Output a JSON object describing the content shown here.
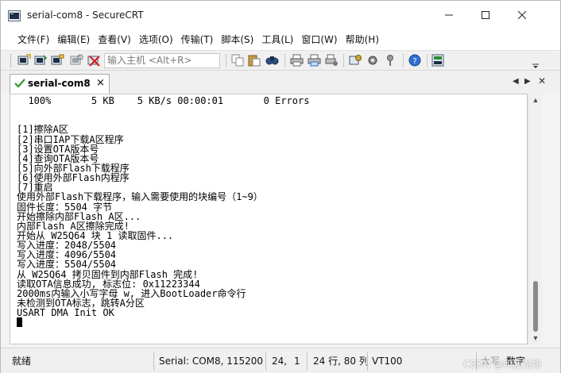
{
  "window": {
    "title": "serial-com8 - SecureCRT"
  },
  "menu": [
    "文件(F)",
    "编辑(E)",
    "查看(V)",
    "选项(O)",
    "传输(T)",
    "脚本(S)",
    "工具(L)",
    "窗口(W)",
    "帮助(H)"
  ],
  "toolbar": {
    "host_placeholder": "输入主机 <Alt+R>"
  },
  "tab": {
    "label": "serial-com8",
    "close": "×"
  },
  "terminal": {
    "lines": [
      "  100%       5 KB    5 KB/s 00:00:01       0 Errors",
      "",
      "",
      "[1]擦除A区",
      "[2]串口IAP下载A区程序",
      "[3]设置OTA版本号",
      "[4]查询OTA版本号",
      "[5]向外部Flash下载程序",
      "[6]使用外部Flash内程序",
      "[7]重启",
      "使用外部Flash下载程序，输入需要使用的块编号（1~9）",
      "固件长度：5504 字节",
      "开始擦除内部Flash A区...",
      "内部Flash A区擦除完成!",
      "开始从 W25Q64 块 1 读取固件...",
      "写入进度：2048/5504",
      "写入进度：4096/5504",
      "写入进度：5504/5504",
      "从 W25Q64 拷贝固件到内部Flash 完成!",
      "读取OTA信息成功, 标志位: 0x11223344",
      "2000ms内输入小写字母 w, 进入BootLoader命令行",
      "未检测到OTA标志，跳转A分区",
      "USART DMA Init OK",
      ""
    ]
  },
  "status": {
    "ready": "就绪",
    "connection": "Serial: COM8, 115200",
    "row": "24,",
    "col": "1",
    "size": "24 行, 80 列",
    "terminal_type": "VT100",
    "caps": "大写",
    "num": "数字"
  },
  "watermark": "CSDN @叫我龙翔"
}
